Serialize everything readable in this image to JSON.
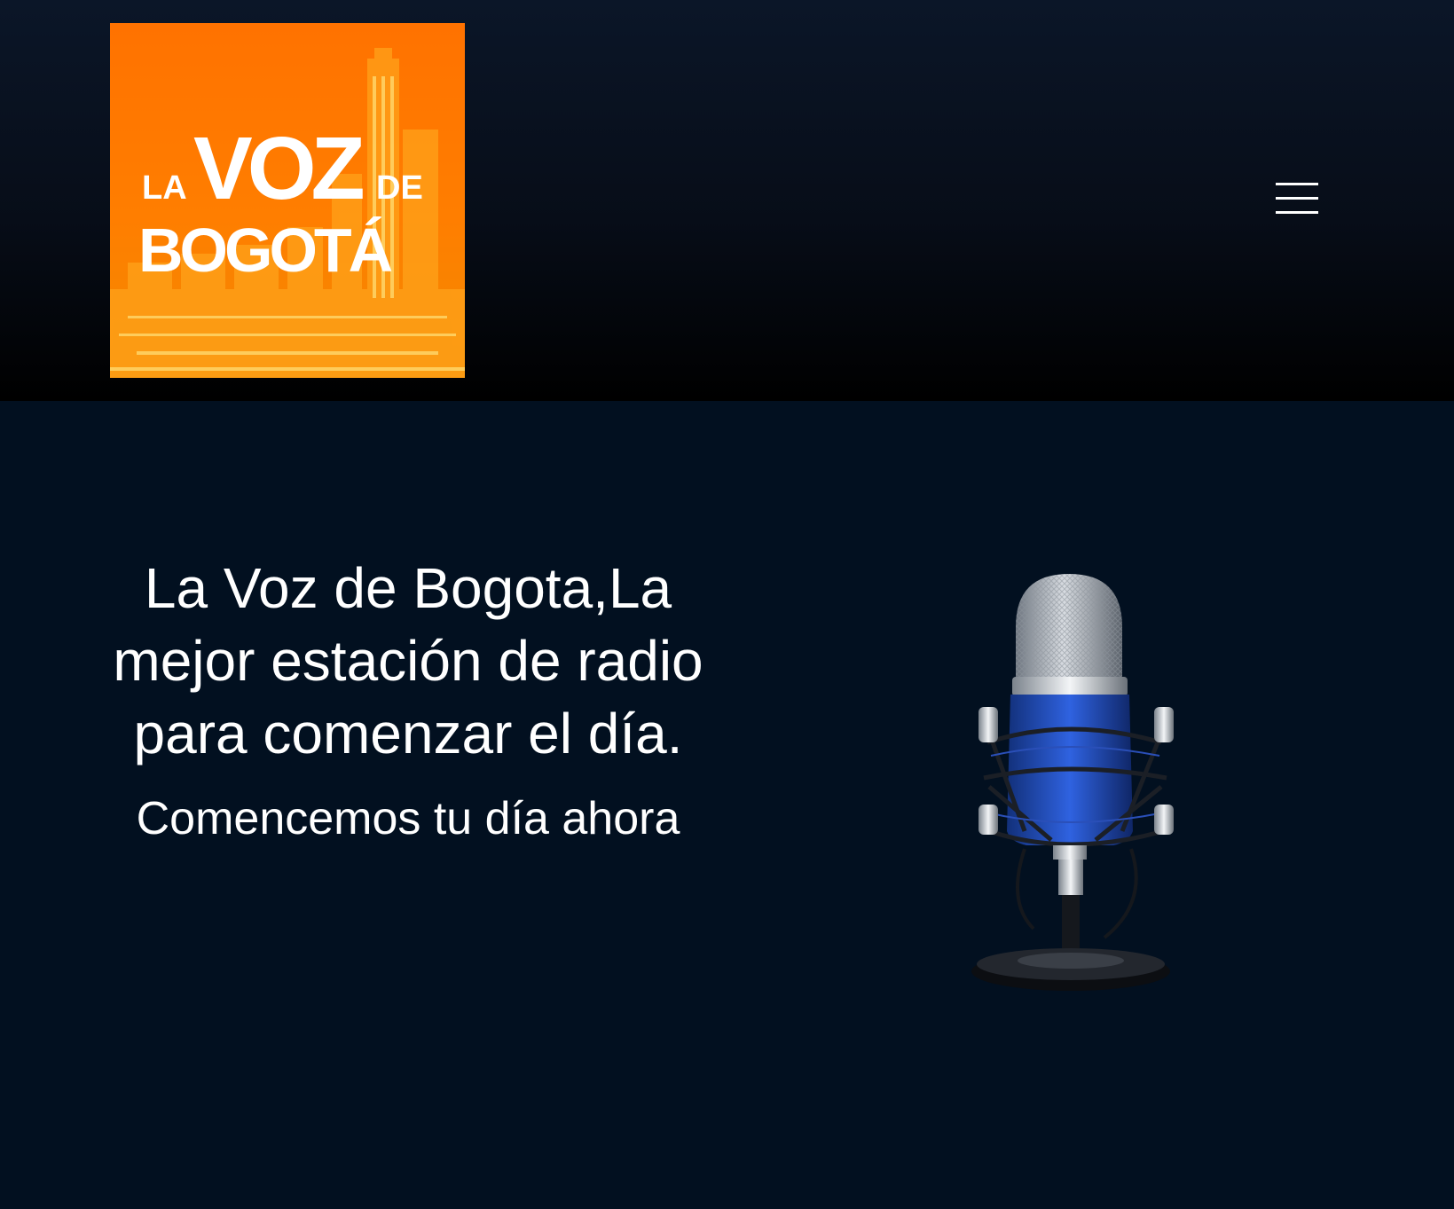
{
  "header": {
    "logo": {
      "line1_small": "LA",
      "line1_big": "VOZ",
      "line1_right": "DE",
      "line2": "BOGOTÁ",
      "background_color": "#ff7a00"
    },
    "menu_icon": "hamburger-menu-icon"
  },
  "hero": {
    "title": "La Voz de Bogota,La mejor estación de radio para comenzar el día.",
    "subtitle": "Comencemos tu día ahora",
    "image_icon": "microphone-image"
  },
  "colors": {
    "page_background": "#021020",
    "header_top": "#0b1628",
    "header_bottom": "#000000",
    "text": "#ffffff",
    "accent_orange": "#ff7a00",
    "mic_blue": "#1f4fcf"
  }
}
